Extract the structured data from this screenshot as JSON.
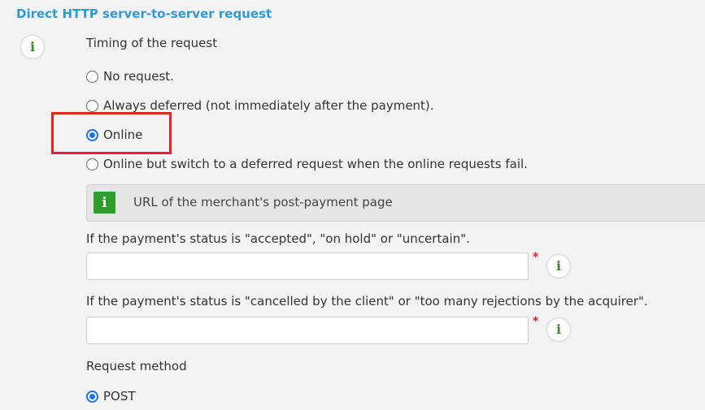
{
  "section": {
    "title": "Direct HTTP server-to-server request"
  },
  "timing": {
    "label": "Timing of the request",
    "options": [
      {
        "label": "No request.",
        "checked": false
      },
      {
        "label": "Always deferred (not immediately after the payment).",
        "checked": false
      },
      {
        "label": "Online",
        "checked": true
      },
      {
        "label": "Online but switch to a deferred request when the online requests fail.",
        "checked": false
      }
    ]
  },
  "url_section": {
    "header": "URL of the merchant's post-payment page",
    "accepted": {
      "label": "If the payment's status is \"accepted\", \"on hold\" or \"uncertain\".",
      "value": "",
      "required_mark": "*"
    },
    "cancelled": {
      "label": "If the payment's status is \"cancelled by the client\" or \"too many rejections by the acquirer\".",
      "value": "",
      "required_mark": "*"
    }
  },
  "method": {
    "label": "Request method",
    "selected": "POST"
  },
  "icons": {
    "info_glyph": "i"
  },
  "colors": {
    "title_blue": "#2e9bd6",
    "highlight_red": "#e0242b",
    "info_green": "#2e9e2a",
    "radio_blue": "#1a73e8"
  }
}
